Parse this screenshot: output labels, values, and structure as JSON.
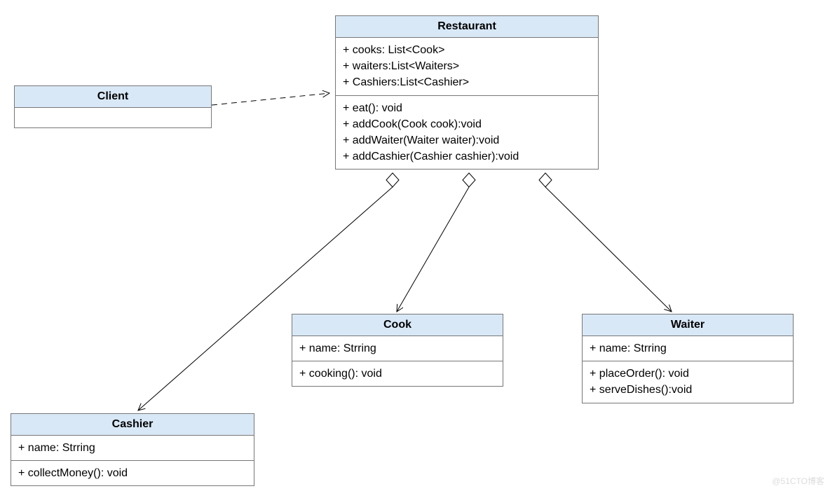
{
  "classes": {
    "client": {
      "name": "Client"
    },
    "restaurant": {
      "name": "Restaurant",
      "attrs": {
        "a0": "+ cooks: List<Cook>",
        "a1": "+ waiters:List<Waiters>",
        "a2": "+ Cashiers:List<Cashier>"
      },
      "ops": {
        "o0": "+ eat(): void",
        "o1": "+ addCook(Cook cook):void",
        "o2": "+ addWaiter(Waiter waiter):void",
        "o3": "+ addCashier(Cashier cashier):void"
      }
    },
    "cook": {
      "name": "Cook",
      "attrs": {
        "a0": "+ name: Strring"
      },
      "ops": {
        "o0": "+ cooking(): void"
      }
    },
    "waiter": {
      "name": "Waiter",
      "attrs": {
        "a0": "+ name: Strring"
      },
      "ops": {
        "o0": "+ placeOrder(): void",
        "o1": "+ serveDishes():void"
      }
    },
    "cashier": {
      "name": "Cashier",
      "attrs": {
        "a0": "+ name: Strring"
      },
      "ops": {
        "o0": "+ collectMoney(): void"
      }
    }
  },
  "relationships": [
    {
      "from": "Client",
      "to": "Restaurant",
      "type": "dependency"
    },
    {
      "from": "Restaurant",
      "to": "Cashier",
      "type": "aggregation"
    },
    {
      "from": "Restaurant",
      "to": "Cook",
      "type": "aggregation"
    },
    {
      "from": "Restaurant",
      "to": "Waiter",
      "type": "aggregation"
    }
  ],
  "watermark": "@51CTO博客"
}
